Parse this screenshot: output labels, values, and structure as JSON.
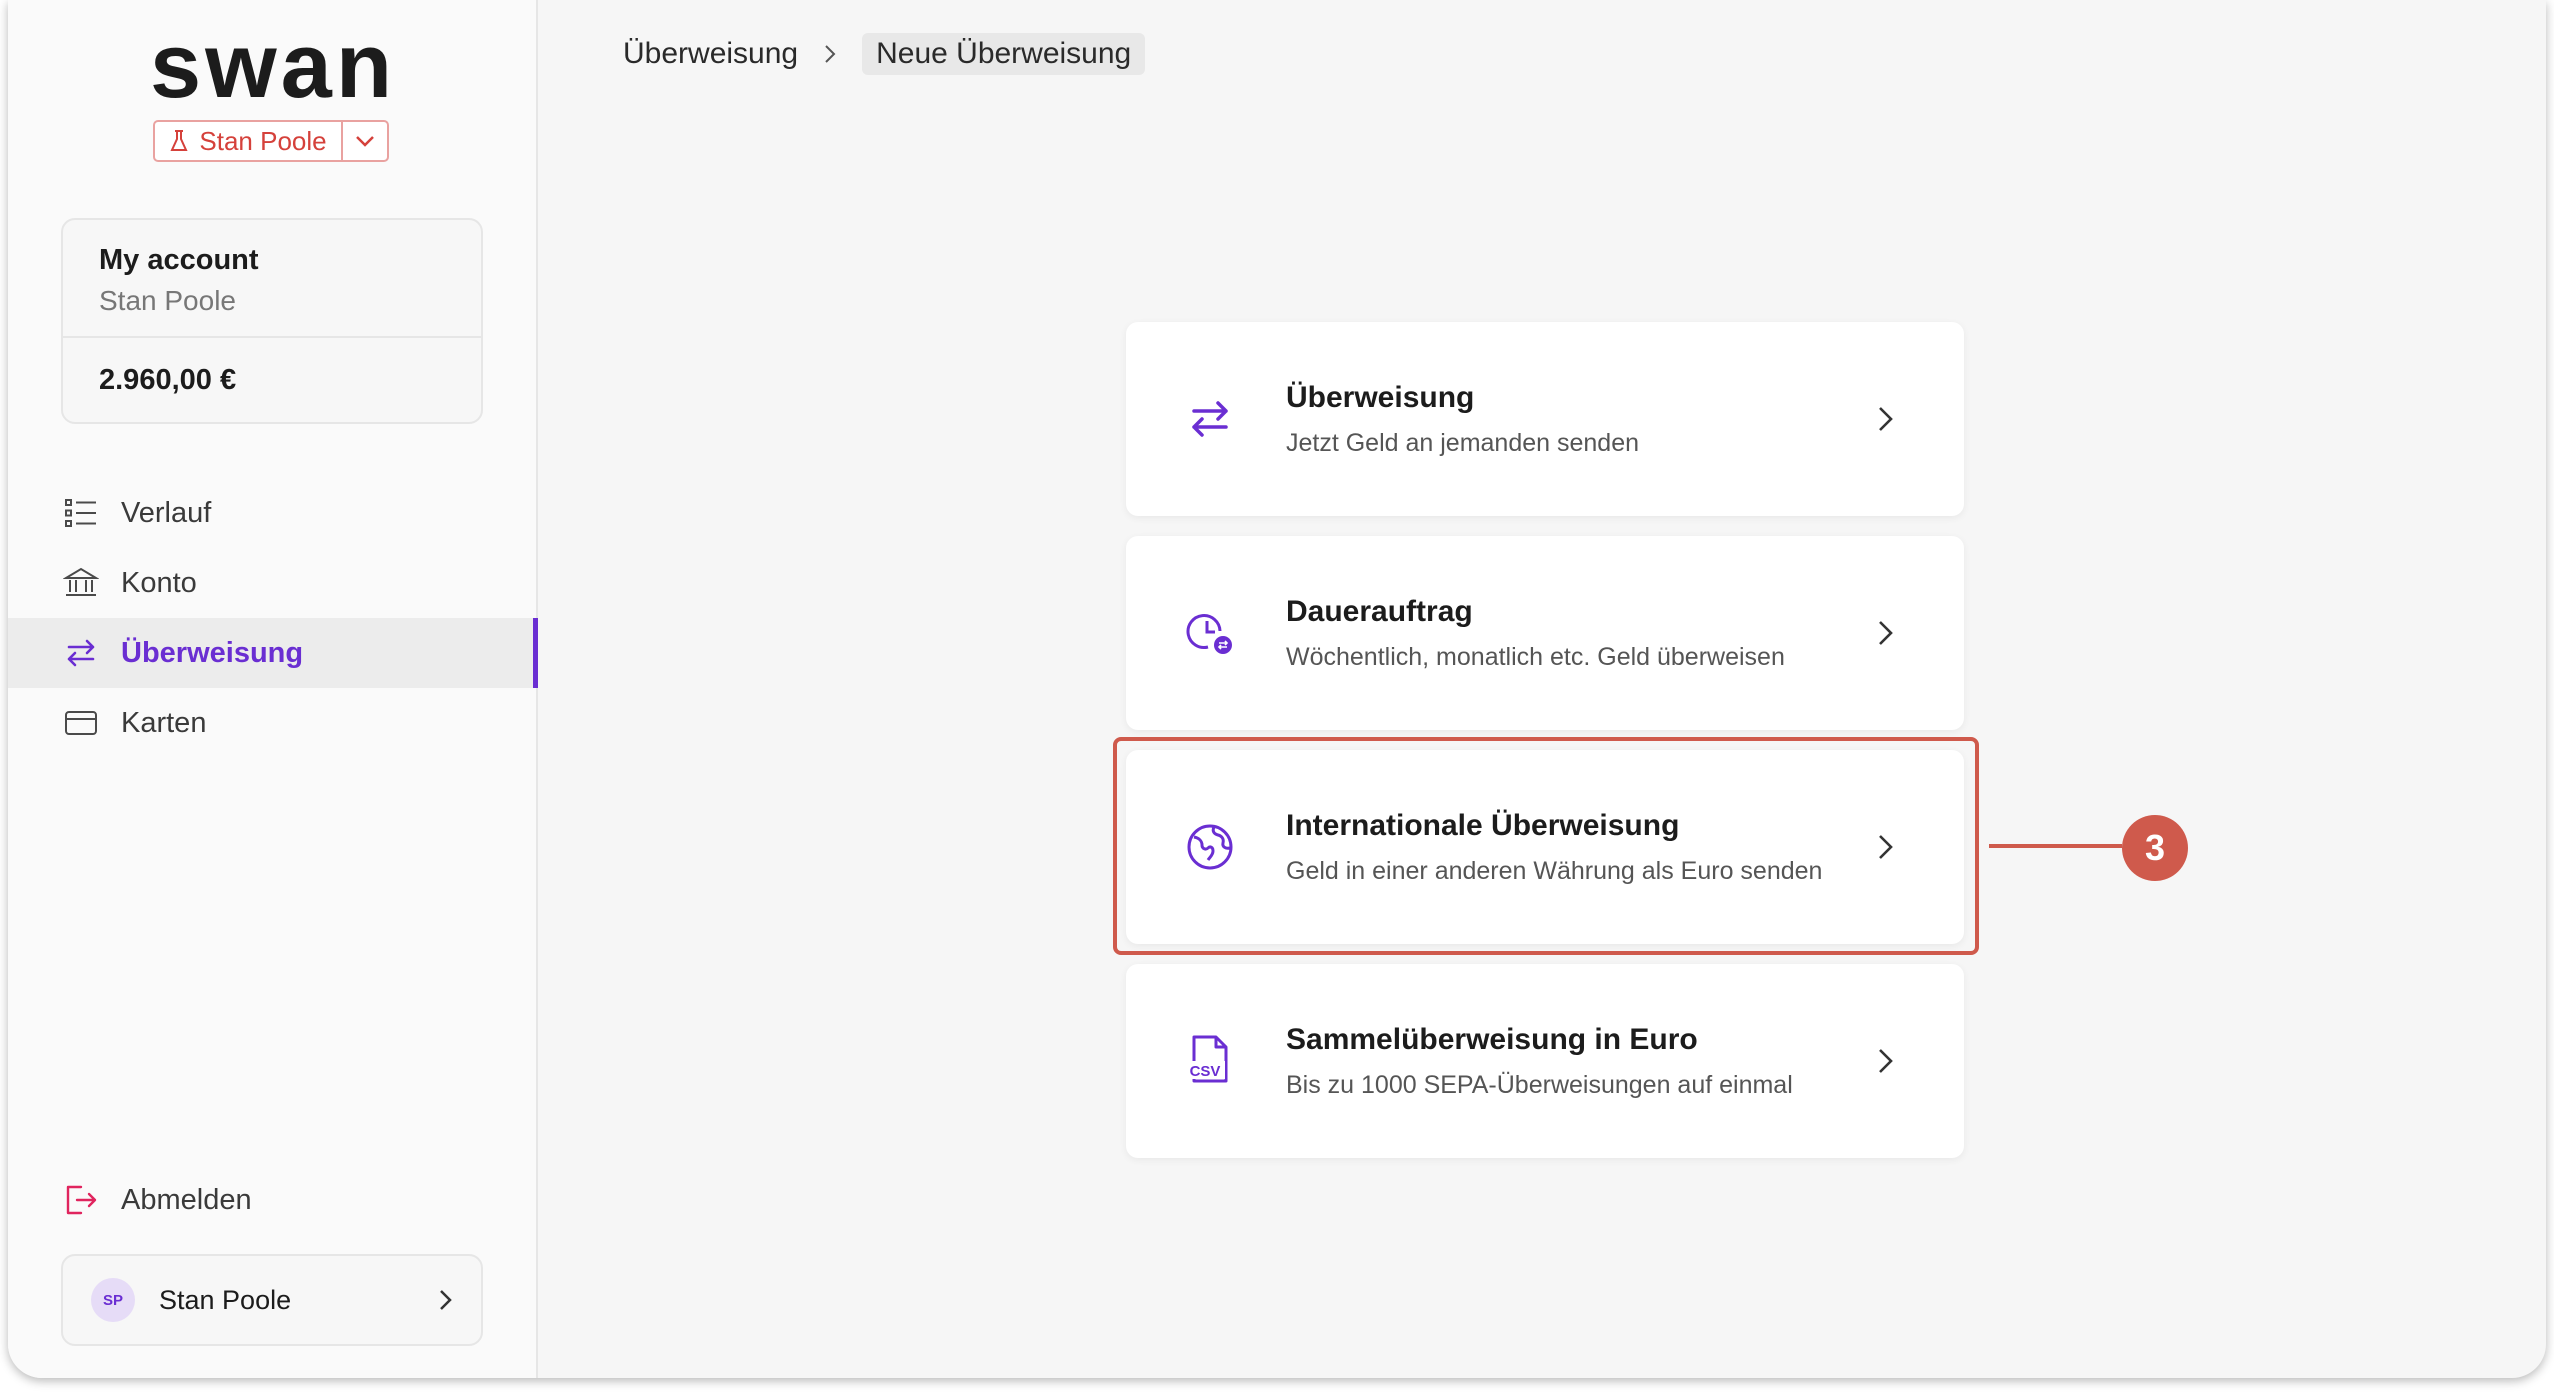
{
  "brand": {
    "name": "swan",
    "accent": "#6a2ed2",
    "danger": "#d5413b"
  },
  "project_switch": {
    "label": "Stan Poole"
  },
  "account": {
    "title": "My account",
    "holder": "Stan Poole",
    "balance": "2.960,00 €"
  },
  "nav": {
    "items": [
      {
        "label": "Verlauf",
        "icon": "list-icon"
      },
      {
        "label": "Konto",
        "icon": "bank-icon"
      },
      {
        "label": "Überweisung",
        "icon": "transfer-icon",
        "active": true
      },
      {
        "label": "Karten",
        "icon": "card-icon"
      }
    ],
    "logout": "Abmelden"
  },
  "profile": {
    "initials": "SP",
    "name": "Stan Poole"
  },
  "breadcrumb": {
    "parent": "Überweisung",
    "current": "Neue Überweisung"
  },
  "options": [
    {
      "title": "Überweisung",
      "desc": "Jetzt Geld an jemanden senden",
      "icon": "transfer-icon"
    },
    {
      "title": "Dauerauftrag",
      "desc": "Wöchentlich, monatlich etc. Geld überweisen",
      "icon": "recurring-clock-icon"
    },
    {
      "title": "Internationale Überweisung",
      "desc": "Geld in einer anderen Währung als Euro senden",
      "icon": "globe-icon",
      "highlighted": true
    },
    {
      "title": "Sammelüberweisung in Euro",
      "desc": "Bis zu 1000 SEPA-Überweisungen auf einmal",
      "icon": "csv-file-icon"
    }
  ],
  "callout": {
    "number": "3"
  }
}
